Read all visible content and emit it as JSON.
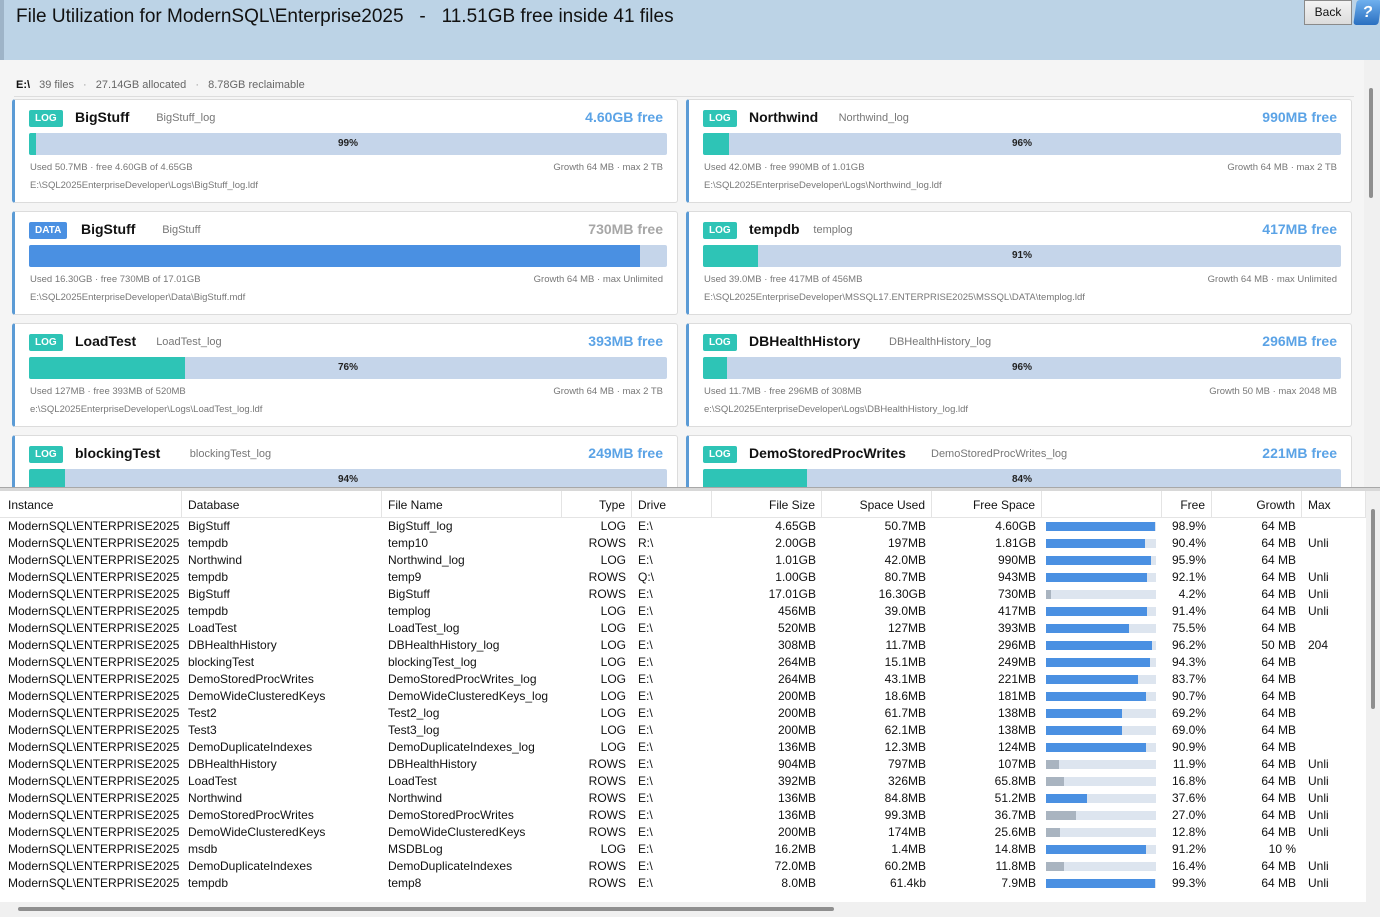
{
  "header": {
    "title": "File Utilization for ModernSQL\\Enterprise2025   -   11.51GB free inside 41 files",
    "back_label": "Back",
    "help_icon": "?"
  },
  "drive": {
    "letter": "E:\\",
    "files": "39 files",
    "allocated": "27.14GB allocated",
    "reclaimable": "8.78GB reclaimable",
    "sep": "·"
  },
  "cards": [
    {
      "type": "LOG",
      "db": "BigStuff",
      "file": "BigStuff_log",
      "free": "4.60GB free",
      "free_muted": false,
      "pct_label": "99%",
      "used_fraction": 0.011,
      "used": "Used 50.7MB  ·  free 4.60GB  of  4.65GB",
      "growth": "Growth 64 MB  ·  max 2 TB",
      "path": "E:\\SQL2025EnterpriseDeveloper\\Logs\\BigStuff_log.ldf"
    },
    {
      "type": "LOG",
      "db": "Northwind",
      "file": "Northwind_log",
      "free": "990MB free",
      "free_muted": false,
      "pct_label": "96%",
      "used_fraction": 0.041,
      "used": "Used 42.0MB  ·  free 990MB  of  1.01GB",
      "growth": "Growth 64 MB  ·  max 2 TB",
      "path": "E:\\SQL2025EnterpriseDeveloper\\Logs\\Northwind_log.ldf"
    },
    {
      "type": "DATA",
      "db": "BigStuff",
      "file": "BigStuff",
      "free": "730MB free",
      "free_muted": true,
      "pct_label": "",
      "used_fraction": 0.958,
      "used": "Used 16.30GB  ·  free 730MB  of  17.01GB",
      "growth": "Growth 64 MB  ·  max Unlimited",
      "path": "E:\\SQL2025EnterpriseDeveloper\\Data\\BigStuff.mdf"
    },
    {
      "type": "LOG",
      "db": "tempdb",
      "file": "templog",
      "free": "417MB free",
      "free_muted": false,
      "pct_label": "91%",
      "used_fraction": 0.086,
      "used": "Used 39.0MB  ·  free 417MB  of  456MB",
      "growth": "Growth 64 MB  ·  max Unlimited",
      "path": "E:\\SQL2025EnterpriseDeveloper\\MSSQL17.ENTERPRISE2025\\MSSQL\\DATA\\templog.ldf"
    },
    {
      "type": "LOG",
      "db": "LoadTest",
      "file": "LoadTest_log",
      "free": "393MB free",
      "free_muted": false,
      "pct_label": "76%",
      "used_fraction": 0.245,
      "used": "Used 127MB  ·  free 393MB  of  520MB",
      "growth": "Growth 64 MB  ·  max 2 TB",
      "path": "e:\\SQL2025EnterpriseDeveloper\\Logs\\LoadTest_log.ldf"
    },
    {
      "type": "LOG",
      "db": "DBHealthHistory",
      "file": "DBHealthHistory_log",
      "free": "296MB free",
      "free_muted": false,
      "pct_label": "96%",
      "used_fraction": 0.038,
      "used": "Used 11.7MB  ·  free 296MB  of  308MB",
      "growth": "Growth 50 MB  ·  max 2048 MB",
      "path": "e:\\SQL2025EnterpriseDeveloper\\Logs\\DBHealthHistory_log.ldf"
    },
    {
      "type": "LOG",
      "db": "blockingTest",
      "file": "blockingTest_log",
      "free": "249MB free",
      "free_muted": false,
      "pct_label": "94%",
      "used_fraction": 0.057,
      "used": "",
      "growth": "",
      "path": ""
    },
    {
      "type": "LOG",
      "db": "DemoStoredProcWrites",
      "file": "DemoStoredProcWrites_log",
      "free": "221MB free",
      "free_muted": false,
      "pct_label": "84%",
      "used_fraction": 0.163,
      "used": "",
      "growth": "",
      "path": ""
    }
  ],
  "grid": {
    "columns": [
      "Instance",
      "Database",
      "File Name",
      "Type",
      "Drive",
      "File Size",
      "Space Used",
      "Free Space",
      "",
      "Free",
      "Growth",
      "Max"
    ],
    "rows": [
      [
        "ModernSQL\\ENTERPRISE2025",
        "BigStuff",
        "BigStuff_log",
        "LOG",
        "E:\\",
        "4.65GB",
        "50.7MB",
        "4.60GB",
        0.989,
        "98.9%",
        "64 MB",
        ""
      ],
      [
        "ModernSQL\\ENTERPRISE2025",
        "tempdb",
        "temp10",
        "ROWS",
        "R:\\",
        "2.00GB",
        "197MB",
        "1.81GB",
        0.904,
        "90.4%",
        "64 MB",
        "Unli"
      ],
      [
        "ModernSQL\\ENTERPRISE2025",
        "Northwind",
        "Northwind_log",
        "LOG",
        "E:\\",
        "1.01GB",
        "42.0MB",
        "990MB",
        0.959,
        "95.9%",
        "64 MB",
        ""
      ],
      [
        "ModernSQL\\ENTERPRISE2025",
        "tempdb",
        "temp9",
        "ROWS",
        "Q:\\",
        "1.00GB",
        "80.7MB",
        "943MB",
        0.921,
        "92.1%",
        "64 MB",
        "Unli"
      ],
      [
        "ModernSQL\\ENTERPRISE2025",
        "BigStuff",
        "BigStuff",
        "ROWS",
        "E:\\",
        "17.01GB",
        "16.30GB",
        "730MB",
        0.042,
        "4.2%",
        "64 MB",
        "Unli"
      ],
      [
        "ModernSQL\\ENTERPRISE2025",
        "tempdb",
        "templog",
        "LOG",
        "E:\\",
        "456MB",
        "39.0MB",
        "417MB",
        0.914,
        "91.4%",
        "64 MB",
        "Unli"
      ],
      [
        "ModernSQL\\ENTERPRISE2025",
        "LoadTest",
        "LoadTest_log",
        "LOG",
        "E:\\",
        "520MB",
        "127MB",
        "393MB",
        0.755,
        "75.5%",
        "64 MB",
        ""
      ],
      [
        "ModernSQL\\ENTERPRISE2025",
        "DBHealthHistory",
        "DBHealthHistory_log",
        "LOG",
        "E:\\",
        "308MB",
        "11.7MB",
        "296MB",
        0.962,
        "96.2%",
        "50 MB",
        "204"
      ],
      [
        "ModernSQL\\ENTERPRISE2025",
        "blockingTest",
        "blockingTest_log",
        "LOG",
        "E:\\",
        "264MB",
        "15.1MB",
        "249MB",
        0.943,
        "94.3%",
        "64 MB",
        ""
      ],
      [
        "ModernSQL\\ENTERPRISE2025",
        "DemoStoredProcWrites",
        "DemoStoredProcWrites_log",
        "LOG",
        "E:\\",
        "264MB",
        "43.1MB",
        "221MB",
        0.837,
        "83.7%",
        "64 MB",
        ""
      ],
      [
        "ModernSQL\\ENTERPRISE2025",
        "DemoWideClusteredKeys",
        "DemoWideClusteredKeys_log",
        "LOG",
        "E:\\",
        "200MB",
        "18.6MB",
        "181MB",
        0.907,
        "90.7%",
        "64 MB",
        ""
      ],
      [
        "ModernSQL\\ENTERPRISE2025",
        "Test2",
        "Test2_log",
        "LOG",
        "E:\\",
        "200MB",
        "61.7MB",
        "138MB",
        0.692,
        "69.2%",
        "64 MB",
        ""
      ],
      [
        "ModernSQL\\ENTERPRISE2025",
        "Test3",
        "Test3_log",
        "LOG",
        "E:\\",
        "200MB",
        "62.1MB",
        "138MB",
        0.69,
        "69.0%",
        "64 MB",
        ""
      ],
      [
        "ModernSQL\\ENTERPRISE2025",
        "DemoDuplicateIndexes",
        "DemoDuplicateIndexes_log",
        "LOG",
        "E:\\",
        "136MB",
        "12.3MB",
        "124MB",
        0.909,
        "90.9%",
        "64 MB",
        ""
      ],
      [
        "ModernSQL\\ENTERPRISE2025",
        "DBHealthHistory",
        "DBHealthHistory",
        "ROWS",
        "E:\\",
        "904MB",
        "797MB",
        "107MB",
        0.119,
        "11.9%",
        "64 MB",
        "Unli"
      ],
      [
        "ModernSQL\\ENTERPRISE2025",
        "LoadTest",
        "LoadTest",
        "ROWS",
        "E:\\",
        "392MB",
        "326MB",
        "65.8MB",
        0.168,
        "16.8%",
        "64 MB",
        "Unli"
      ],
      [
        "ModernSQL\\ENTERPRISE2025",
        "Northwind",
        "Northwind",
        "ROWS",
        "E:\\",
        "136MB",
        "84.8MB",
        "51.2MB",
        0.376,
        "37.6%",
        "64 MB",
        "Unli"
      ],
      [
        "ModernSQL\\ENTERPRISE2025",
        "DemoStoredProcWrites",
        "DemoStoredProcWrites",
        "ROWS",
        "E:\\",
        "136MB",
        "99.3MB",
        "36.7MB",
        0.27,
        "27.0%",
        "64 MB",
        "Unli"
      ],
      [
        "ModernSQL\\ENTERPRISE2025",
        "DemoWideClusteredKeys",
        "DemoWideClusteredKeys",
        "ROWS",
        "E:\\",
        "200MB",
        "174MB",
        "25.6MB",
        0.128,
        "12.8%",
        "64 MB",
        "Unli"
      ],
      [
        "ModernSQL\\ENTERPRISE2025",
        "msdb",
        "MSDBLog",
        "LOG",
        "E:\\",
        "16.2MB",
        "1.4MB",
        "14.8MB",
        0.912,
        "91.2%",
        "10 %",
        ""
      ],
      [
        "ModernSQL\\ENTERPRISE2025",
        "DemoDuplicateIndexes",
        "DemoDuplicateIndexes",
        "ROWS",
        "E:\\",
        "72.0MB",
        "60.2MB",
        "11.8MB",
        0.164,
        "16.4%",
        "64 MB",
        "Unli"
      ],
      [
        "ModernSQL\\ENTERPRISE2025",
        "tempdb",
        "temp8",
        "ROWS",
        "E:\\",
        "8.0MB",
        "61.4kb",
        "7.9MB",
        0.993,
        "99.3%",
        "64 MB",
        "Unli"
      ]
    ]
  },
  "colors": {
    "log": "#2ec4b6",
    "data": "#4a90e2",
    "free_text": "#5ba3e6",
    "bar_bg": "#c5d5ea"
  }
}
